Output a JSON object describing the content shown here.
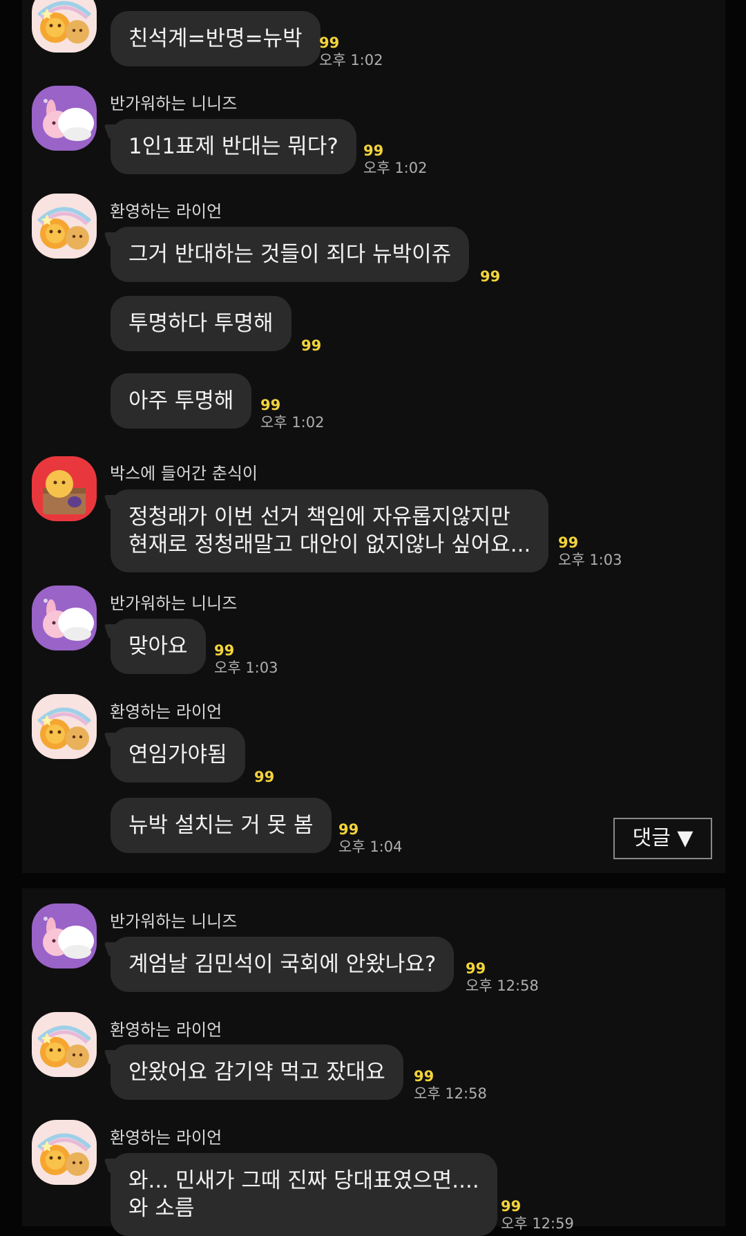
{
  "comment_button": {
    "label": "댓글 ▼"
  },
  "panels": [
    {
      "messages": [
        {
          "bubbles": [
            {
              "text": "친석계=반명=뉴박",
              "count": "99",
              "time": "오후 1:02"
            }
          ]
        },
        {
          "sender": "반가워하는 니니즈",
          "avatar": "ninize-avatar",
          "bubbles": [
            {
              "text": "1인1표제 반대는 뭐다?",
              "count": "99",
              "time": "오후 1:02"
            }
          ]
        },
        {
          "sender": "환영하는 라이언",
          "avatar": "lion-avatar",
          "bubbles": [
            {
              "text": "그거 반대하는 것들이 죄다 뉴박이쥬",
              "count": "99"
            },
            {
              "text": "투명하다 투명해",
              "count": "99"
            },
            {
              "text": "아주 투명해",
              "count": "99",
              "time": "오후 1:02"
            }
          ]
        },
        {
          "sender": "박스에 들어간 춘식이",
          "avatar": "choonsik-avatar",
          "bubbles": [
            {
              "lines": [
                "정청래가 이번 선거 책임에 자유롭지않지만",
                "현재로 정청래말고 대안이 없지않나 싶어요..."
              ],
              "count": "99",
              "time": "오후 1:03"
            }
          ]
        },
        {
          "sender": "반가워하는 니니즈",
          "avatar": "ninize-avatar",
          "bubbles": [
            {
              "text": "맞아요",
              "count": "99",
              "time": "오후 1:03"
            }
          ]
        },
        {
          "sender": "환영하는 라이언",
          "avatar": "lion-avatar",
          "bubbles": [
            {
              "text": "연임가야됨",
              "count": "99"
            },
            {
              "text": "뉴박 설치는 거 못 봄",
              "count": "99",
              "time": "오후 1:04"
            }
          ]
        }
      ]
    },
    {
      "messages": [
        {
          "sender": "반가워하는 니니즈",
          "avatar": "ninize-avatar",
          "bubbles": [
            {
              "text": "계엄날 김민석이 국회에 안왔나요?",
              "count": "99",
              "time": "오후 12:58"
            }
          ]
        },
        {
          "sender": "환영하는 라이언",
          "avatar": "lion-avatar",
          "bubbles": [
            {
              "text": "안왔어요 감기약 먹고 잤대요",
              "count": "99",
              "time": "오후 12:58"
            }
          ]
        },
        {
          "sender": "환영하는 라이언",
          "avatar": "lion-avatar",
          "bubbles": [
            {
              "lines": [
                "와... 민새가 그때 진짜 당대표였으면....",
                "와 소름"
              ],
              "count": "99",
              "time": "오후 12:59"
            }
          ]
        }
      ]
    }
  ]
}
